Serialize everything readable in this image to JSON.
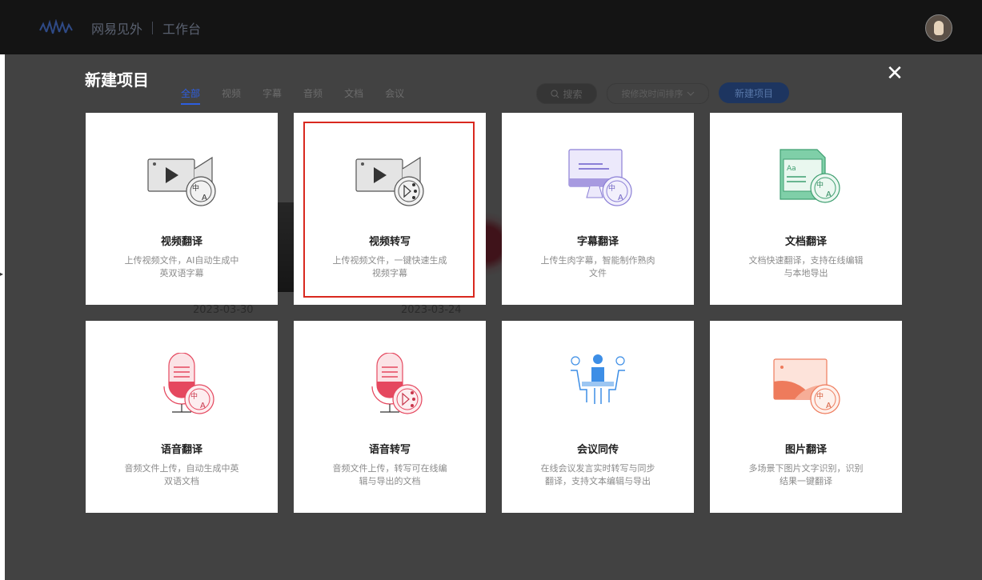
{
  "header": {
    "brand": "网易见外",
    "section": "工作台"
  },
  "background": {
    "dates": [
      "2023-03-30",
      "2023-03-24"
    ]
  },
  "modal": {
    "title": "新建项目",
    "tabs": [
      {
        "label": "全部",
        "active": true
      },
      {
        "label": "视频"
      },
      {
        "label": "字幕"
      },
      {
        "label": "音频"
      },
      {
        "label": "文档"
      },
      {
        "label": "会议"
      }
    ],
    "search_label": "搜索",
    "sort_label": "按修改时间排序",
    "new_button": "新建项目",
    "close_glyph": "✕",
    "cards": [
      {
        "title": "视频翻译",
        "desc": "上传视频文件，AI自动生成中英双语字幕",
        "icon": "video-translate-icon"
      },
      {
        "title": "视频转写",
        "desc": "上传视频文件，一键快速生成视频字幕",
        "icon": "video-transcribe-icon"
      },
      {
        "title": "字幕翻译",
        "desc": "上传生肉字幕，智能制作熟肉文件",
        "icon": "subtitle-translate-icon"
      },
      {
        "title": "文档翻译",
        "desc": "文档快速翻译，支持在线编辑与本地导出",
        "icon": "document-translate-icon"
      },
      {
        "title": "语音翻译",
        "desc": "音频文件上传，自动生成中英双语文档",
        "icon": "audio-translate-icon"
      },
      {
        "title": "语音转写",
        "desc": "音频文件上传，转写可在线编辑与导出的文档",
        "icon": "audio-transcribe-icon"
      },
      {
        "title": "会议同传",
        "desc": "在线会议发言实时转写与同步翻译，支持文本编辑与导出",
        "icon": "meeting-interpretation-icon"
      },
      {
        "title": "图片翻译",
        "desc": "多场景下图片文字识别，识别结果一键翻译",
        "icon": "image-translate-icon"
      }
    ]
  },
  "colors": {
    "accent": "#2d5ee0",
    "highlight": "#d9281f",
    "video_gray": "#e4e4e4",
    "subtitle_purple": "#a79ae0",
    "doc_green": "#7fcfa8",
    "audio_red": "#e5485f",
    "meeting_blue": "#3d8ee6",
    "image_orange": "#ee7b5c"
  }
}
